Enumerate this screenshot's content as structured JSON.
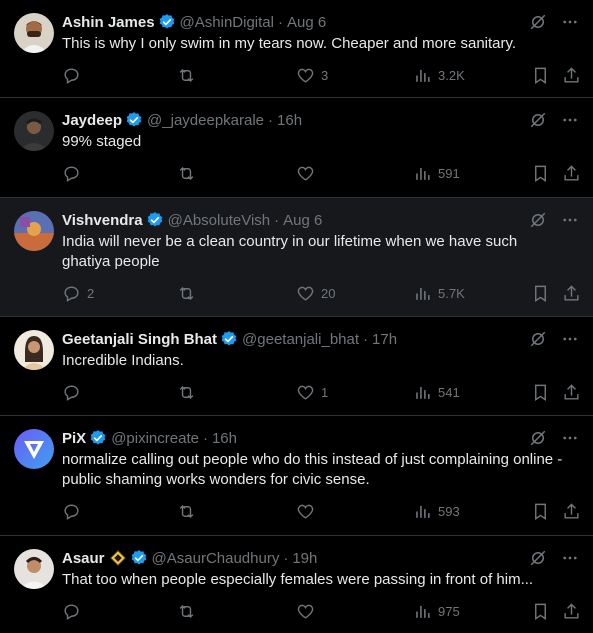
{
  "tweets": [
    {
      "name": "Ashin James",
      "handle": "@AshinDigital",
      "time": "Aug 6",
      "text": "This is why I only swim in my tears now. Cheaper and more sanitary.",
      "replies": "",
      "retweets": "",
      "likes": "3",
      "views": "3.2K",
      "highlight": false
    },
    {
      "name": "Jaydeep",
      "handle": "@_jaydeepkarale",
      "time": "16h",
      "text": "99% staged",
      "replies": "",
      "retweets": "",
      "likes": "",
      "views": "591",
      "highlight": false
    },
    {
      "name": "Vishvendra",
      "handle": "@AbsoluteVish",
      "time": "Aug 6",
      "text": "India will never be a clean country in our lifetime when we have such ghatiya people",
      "replies": "2",
      "retweets": "",
      "likes": "20",
      "views": "5.7K",
      "highlight": true
    },
    {
      "name": "Geetanjali Singh Bhat",
      "handle": "@geetanjali_bhat",
      "time": "17h",
      "text": "Incredible Indians.",
      "replies": "",
      "retweets": "",
      "likes": "1",
      "views": "541",
      "highlight": false
    },
    {
      "name": "PiX",
      "handle": "@pixincreate",
      "time": "16h",
      "text": "normalize calling out people who do this instead of just complaining online - public shaming works wonders for civic sense.",
      "replies": "",
      "retweets": "",
      "likes": "",
      "views": "593",
      "highlight": false
    },
    {
      "name": "Asaur",
      "handle": "@AsaurChaudhury",
      "time": "19h",
      "text": "That too when people especially females were passing in front of him...",
      "replies": "",
      "retweets": "",
      "likes": "",
      "views": "975",
      "highlight": false
    }
  ],
  "separator": "·",
  "colors": {
    "background": "#000000",
    "highlight_bg": "#16181c",
    "verified": "#1d9bf0",
    "muted": "#71767b",
    "text": "#e7e9ea",
    "border": "#2f3336"
  },
  "icons": [
    "verified-badge-icon",
    "grok-icon",
    "more-icon",
    "reply-icon",
    "retweet-icon",
    "like-icon",
    "views-icon",
    "bookmark-icon",
    "share-icon"
  ]
}
